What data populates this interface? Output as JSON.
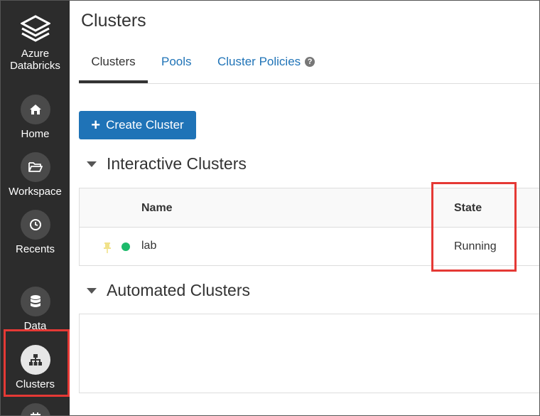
{
  "sidebar": {
    "logo_label": "Azure Databricks",
    "items": [
      {
        "label": "Home",
        "icon": "home-icon"
      },
      {
        "label": "Workspace",
        "icon": "folder-icon"
      },
      {
        "label": "Recents",
        "icon": "clock-icon"
      },
      {
        "label": "Data",
        "icon": "database-icon"
      },
      {
        "label": "Clusters",
        "icon": "cluster-icon",
        "active": true
      }
    ]
  },
  "page": {
    "title": "Clusters",
    "tabs": [
      {
        "label": "Clusters",
        "active": true
      },
      {
        "label": "Pools"
      },
      {
        "label": "Cluster Policies"
      }
    ],
    "create_button": "Create Cluster"
  },
  "interactive": {
    "heading": "Interactive Clusters",
    "columns": [
      "Name",
      "State"
    ],
    "rows": [
      {
        "name": "lab",
        "state": "Running",
        "status_color": "#1dba6b"
      }
    ]
  },
  "automated": {
    "heading": "Automated Clusters"
  },
  "colors": {
    "accent": "#1f73b7",
    "sidebar": "#2c2c2c",
    "highlight": "#e53935"
  }
}
